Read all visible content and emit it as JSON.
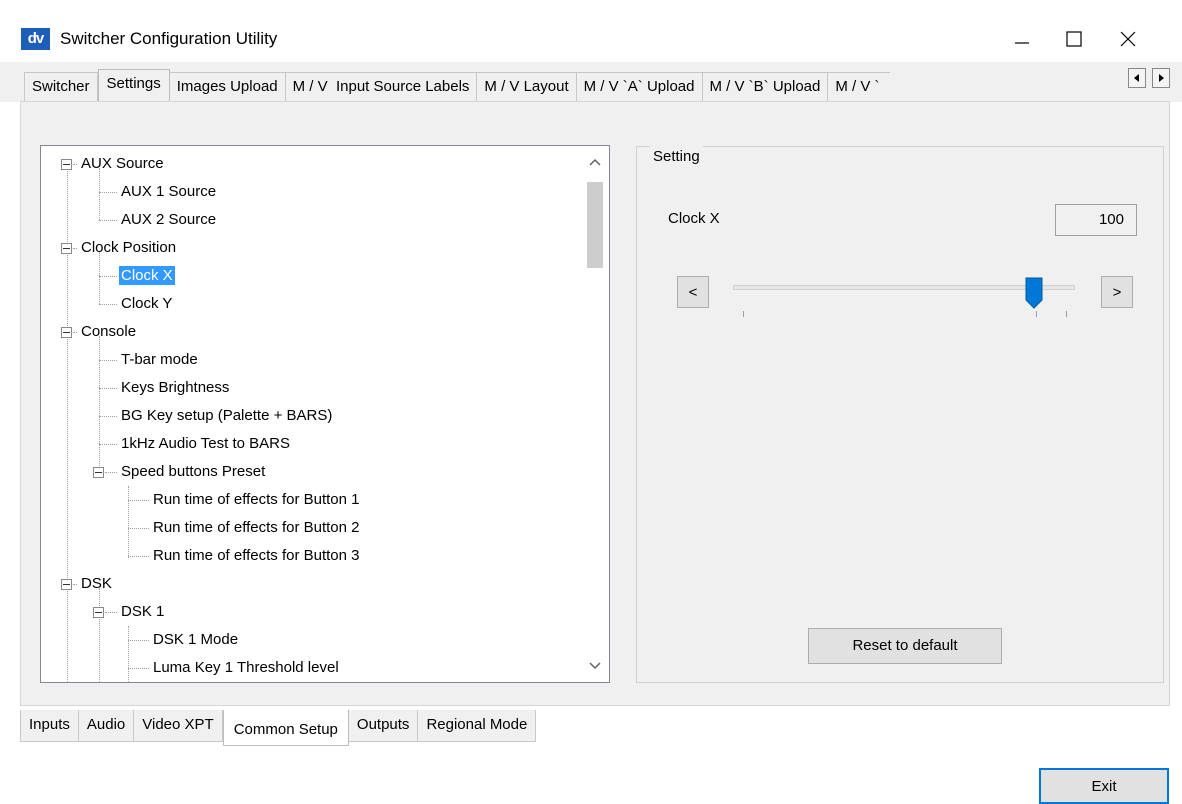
{
  "window": {
    "logo_text": "dv",
    "title": "Switcher Configuration Utility"
  },
  "top_tabs": [
    {
      "label": "Switcher"
    },
    {
      "label": "Settings",
      "active": true
    },
    {
      "label": "Images Upload"
    },
    {
      "label": "M / V  Input Source Labels"
    },
    {
      "label": "M / V Layout"
    },
    {
      "label": "M / V `A` Upload"
    },
    {
      "label": "M / V `B` Upload"
    },
    {
      "label": "M / V `"
    }
  ],
  "tree": {
    "items": [
      {
        "label": "AUX Source",
        "level": 0,
        "expandable": true
      },
      {
        "label": "AUX 1 Source",
        "level": 1
      },
      {
        "label": "AUX 2 Source",
        "level": 1
      },
      {
        "label": "Clock Position",
        "level": 0,
        "expandable": true
      },
      {
        "label": "Clock X",
        "level": 1,
        "selected": true
      },
      {
        "label": "Clock Y",
        "level": 1
      },
      {
        "label": "Console",
        "level": 0,
        "expandable": true
      },
      {
        "label": "T-bar mode",
        "level": 1
      },
      {
        "label": "Keys Brightness",
        "level": 1
      },
      {
        "label": "BG Key setup (Palette + BARS)",
        "level": 1
      },
      {
        "label": "1kHz Audio Test to BARS",
        "level": 1
      },
      {
        "label": "Speed buttons Preset",
        "level": 1,
        "expandable": true
      },
      {
        "label": "Run time of effects for Button 1",
        "level": 2
      },
      {
        "label": "Run time of effects for Button 2",
        "level": 2
      },
      {
        "label": "Run time of effects for Button 3",
        "level": 2
      },
      {
        "label": "DSK",
        "level": 0,
        "expandable": true
      },
      {
        "label": "DSK 1",
        "level": 1,
        "expandable": true
      },
      {
        "label": "DSK 1 Mode",
        "level": 2
      },
      {
        "label": "Luma Key 1 Threshold level",
        "level": 2
      }
    ]
  },
  "setting": {
    "group_title": "Setting",
    "name": "Clock X",
    "value": "100",
    "slider_fraction": 0.88,
    "prev_label": "<",
    "next_label": ">",
    "reset_label": "Reset to default"
  },
  "bottom_tabs": [
    {
      "label": "Inputs"
    },
    {
      "label": "Audio"
    },
    {
      "label": "Video XPT"
    },
    {
      "label": "Common Setup",
      "active": true
    },
    {
      "label": "Outputs"
    },
    {
      "label": "Regional Mode"
    }
  ],
  "exit_label": "Exit",
  "colors": {
    "accent": "#0078d7",
    "selection": "#3399ff",
    "logo": "#1d5fb8"
  }
}
